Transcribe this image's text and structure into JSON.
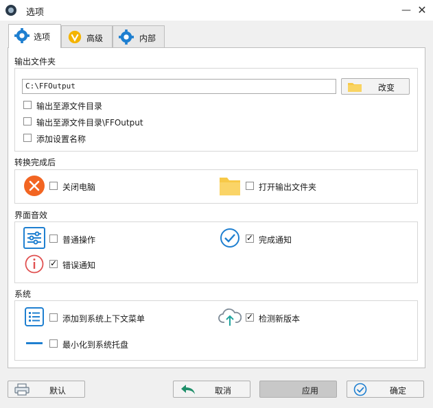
{
  "window": {
    "title": "选项"
  },
  "tabs": [
    {
      "label": "选项"
    },
    {
      "label": "高级"
    },
    {
      "label": "内部"
    }
  ],
  "output": {
    "title": "输出文件夹",
    "path": "C:\\FFOutput",
    "change_label": "改变",
    "options": [
      {
        "label": "输出至源文件目录",
        "checked": false
      },
      {
        "label": "输出至源文件目录\\FFOutput",
        "checked": false
      },
      {
        "label": "添加设置名称",
        "checked": false
      }
    ]
  },
  "after": {
    "title": "转换完成后",
    "shutdown_label": "关闭电脑",
    "open_folder_label": "打开输出文件夹"
  },
  "sound": {
    "title": "界面音效",
    "normal_label": "普通操作",
    "done_label": "完成通知",
    "error_label": "错误通知"
  },
  "system": {
    "title": "系统",
    "context_menu_label": "添加到系统上下文菜单",
    "update_label": "检测新版本",
    "tray_label": "最小化到系统托盘"
  },
  "buttons": {
    "default_label": "默认",
    "cancel_label": "取消",
    "apply_label": "应用",
    "ok_label": "确定"
  },
  "colors": {
    "accent": "#1e7fd0",
    "folder": "#f7c948",
    "shutdown": "#f26522",
    "error": "#e05050"
  }
}
